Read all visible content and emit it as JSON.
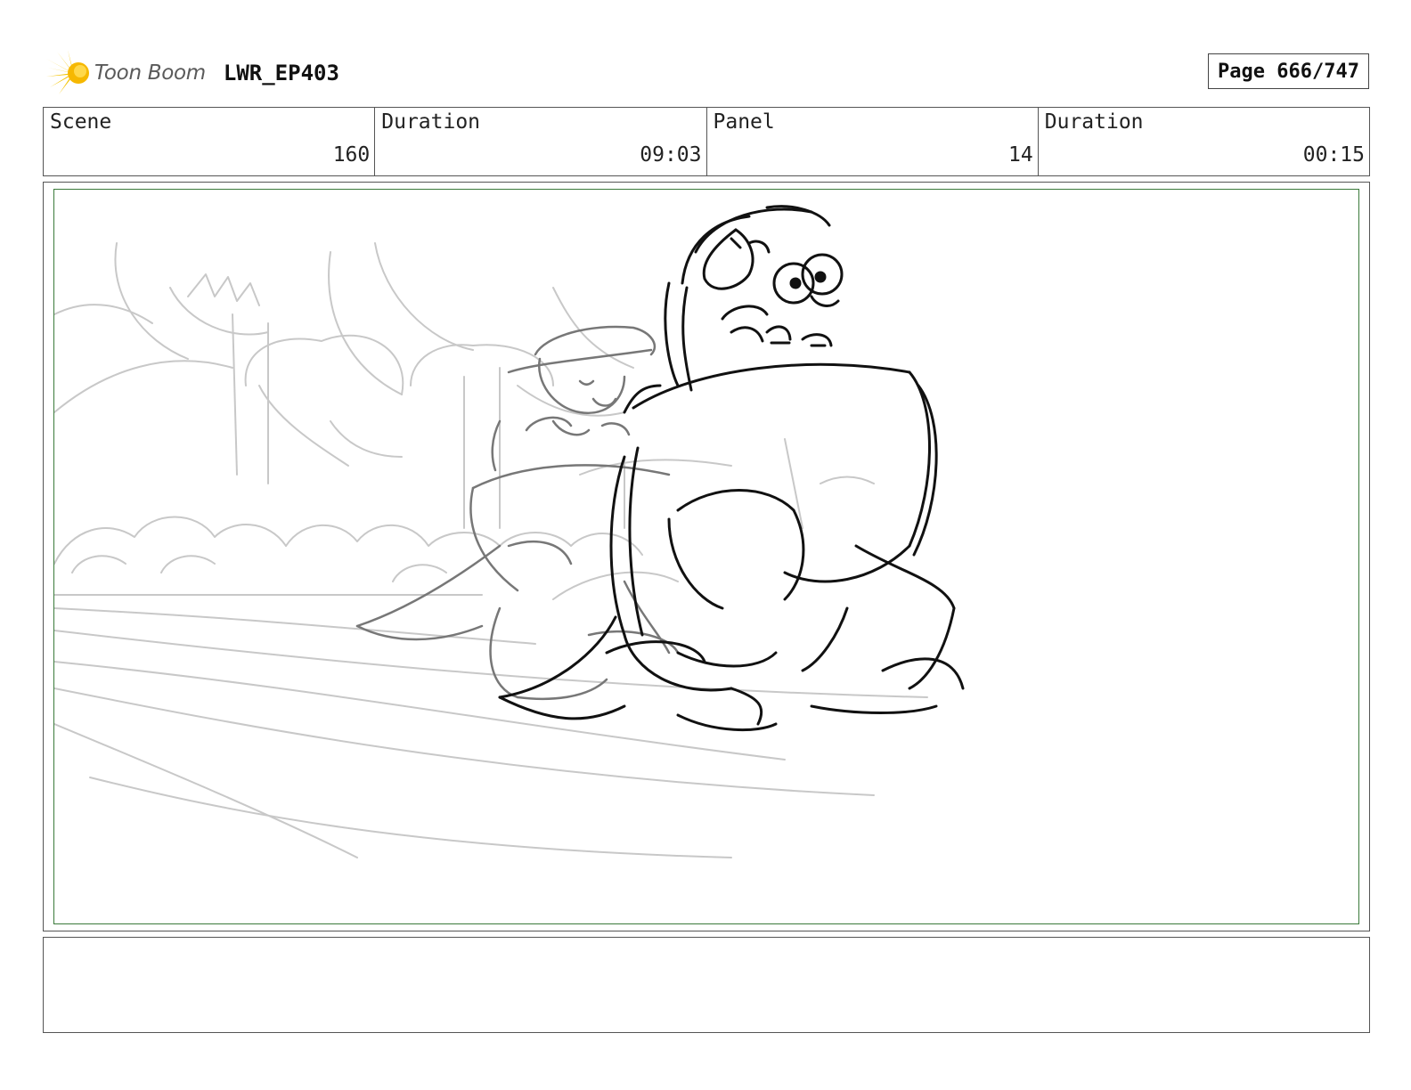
{
  "header": {
    "logo_text": "Toon Boom",
    "project": "LWR_EP403",
    "page": "Page 666/747"
  },
  "info": {
    "scene_label": "Scene",
    "scene_value": "160",
    "duration_label": "Duration",
    "duration_value": "09:03",
    "panel_label": "Panel",
    "panel_value": "14",
    "panel_duration_label": "Duration",
    "panel_duration_value": "00:15"
  },
  "colors": {
    "frame_border": "#3a7a3a",
    "sketch_dark": "#111111",
    "sketch_mid": "#777777",
    "sketch_light": "#c8c8c8",
    "logo_yellow": "#f3c300"
  },
  "notes": {
    "text": ""
  }
}
